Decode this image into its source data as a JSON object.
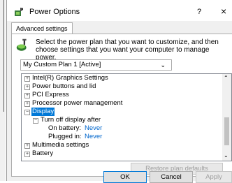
{
  "window": {
    "title": "Power Options",
    "help": "?",
    "close": "×",
    "icon": "power-options-icon"
  },
  "tab": {
    "label": "Advanced settings"
  },
  "info": {
    "text": "Select the power plan that you want to customize, and then choose settings that you want your computer to manage power.",
    "icon": "power-plan-icon"
  },
  "plan_select": {
    "value": "My Custom Plan 1 [Active]"
  },
  "tree": {
    "items": [
      {
        "label": "Intel(R) Graphics Settings",
        "expander": "+"
      },
      {
        "label": "Power buttons and lid",
        "expander": "+"
      },
      {
        "label": "PCI Express",
        "expander": "+"
      },
      {
        "label": "Processor power management",
        "expander": "+"
      },
      {
        "label": "Display",
        "expander": "−",
        "selected": true
      },
      {
        "label": "Turn off display after",
        "expander": "−"
      },
      {
        "label": "On battery:",
        "value": "Never"
      },
      {
        "label": "Plugged in:",
        "value": "Never"
      },
      {
        "label": "Multimedia settings",
        "expander": "+"
      },
      {
        "label": "Battery",
        "expander": "+"
      }
    ]
  },
  "buttons": {
    "restore": "Restore plan defaults",
    "ok": "OK",
    "cancel": "Cancel",
    "apply": "Apply"
  }
}
